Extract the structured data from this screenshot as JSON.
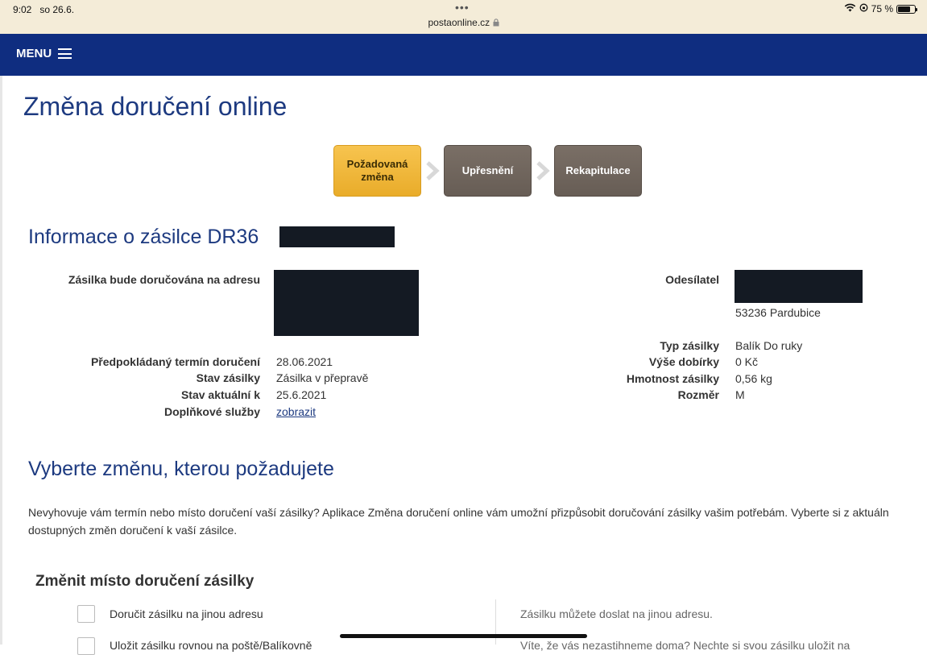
{
  "statusbar": {
    "time": "9:02",
    "date": "so 26.6.",
    "dots": "•••",
    "url": "postaonline.cz",
    "battery": "75 %",
    "battery_level": 0.75
  },
  "nav": {
    "menu_label": "MENU"
  },
  "page": {
    "title": "Změna doručení online"
  },
  "steps": [
    {
      "label": "Požadovaná změna",
      "state": "active"
    },
    {
      "label": "Upřesnění",
      "state": "inactive"
    },
    {
      "label": "Rekapitulace",
      "state": "inactive"
    }
  ],
  "info": {
    "title": "Informace o zásilce DR36",
    "delivery_address_label": "Zásilka bude doručována na adresu",
    "expected_delivery_label": "Předpokládaný termín doručení",
    "expected_delivery_value": "28.06.2021",
    "status_label": "Stav zásilky",
    "status_value": "Zásilka v přepravě",
    "status_date_label": "Stav aktuální k",
    "status_date_value": "25.6.2021",
    "extra_services_label": "Doplňkové služby",
    "extra_services_link": "zobrazit",
    "sender_label": "Odesílatel",
    "sender_city": "53236  Pardubice",
    "type_label": "Typ zásilky",
    "type_value": "Balík Do ruky",
    "cod_label": "Výše dobírky",
    "cod_value": "0 Kč",
    "weight_label": "Hmotnost zásilky",
    "weight_value": "0,56 kg",
    "size_label": "Rozměr",
    "size_value": "M"
  },
  "choose": {
    "title": "Vyberte změnu, kterou požadujete",
    "desc_line1": "Nevyhovuje vám termín nebo místo doručení vaší zásilky? Aplikace Změna doručení online vám umožní přizpůsobit doručování zásilky vašim potřebám. Vyberte si z aktuáln",
    "desc_line2": "dostupných změn doručení k vaší zásilce."
  },
  "change_place": {
    "title": "Změnit místo doručení zásilky",
    "options": [
      {
        "label": "Doručit zásilku na jinou adresu",
        "info": "Zásilku můžete doslat na jinou adresu."
      },
      {
        "label": "Uložit zásilku rovnou na poště/Balíkovně",
        "info": "Víte, že vás nezastihneme doma? Nechte si svou zásilku uložit na"
      }
    ]
  }
}
